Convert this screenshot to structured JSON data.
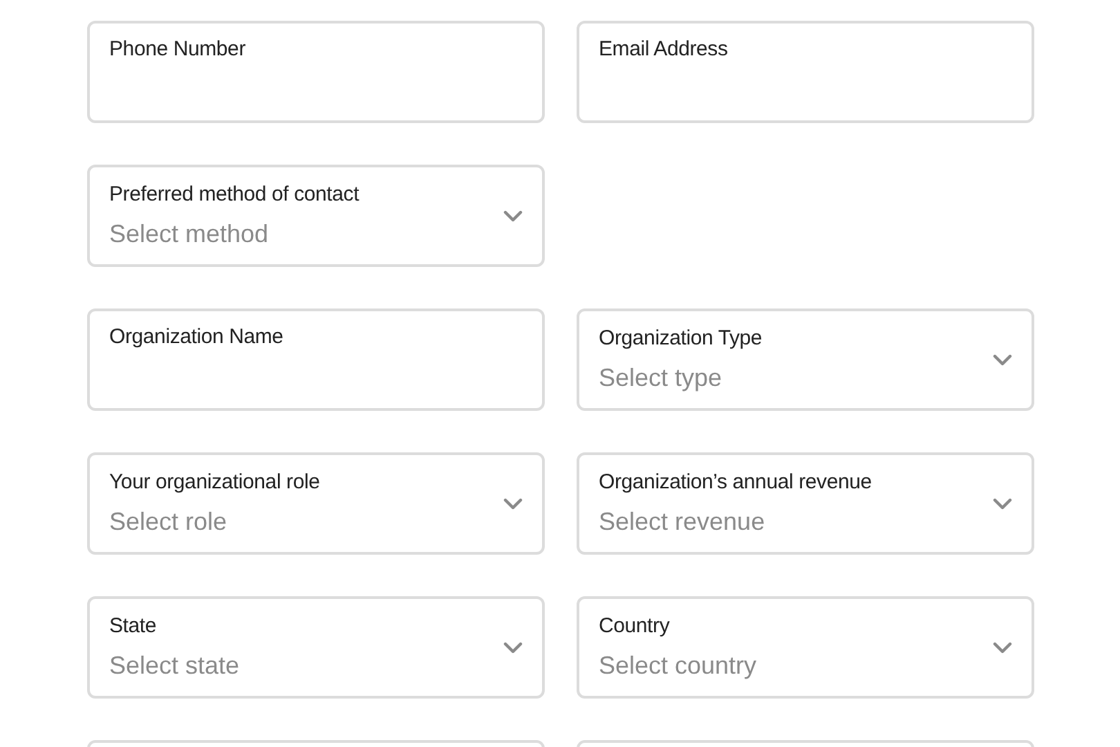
{
  "rows": [
    {
      "fields": [
        {
          "kind": "text",
          "label": "Phone Number"
        },
        {
          "kind": "text",
          "label": "Email Address"
        }
      ]
    },
    {
      "fields": [
        {
          "kind": "select",
          "label": "Preferred method of contact",
          "placeholder": "Select method"
        }
      ]
    },
    {
      "fields": [
        {
          "kind": "text",
          "label": "Organization Name"
        },
        {
          "kind": "select",
          "label": "Organization Type",
          "placeholder": "Select type"
        }
      ]
    },
    {
      "fields": [
        {
          "kind": "select",
          "label": "Your organizational role",
          "placeholder": "Select role"
        },
        {
          "kind": "select",
          "label": "Organization’s annual revenue",
          "placeholder": "Select revenue"
        }
      ]
    },
    {
      "fields": [
        {
          "kind": "select",
          "label": "State",
          "placeholder": "Select state"
        },
        {
          "kind": "select",
          "label": "Country",
          "placeholder": "Select country"
        }
      ]
    },
    {
      "fields": [
        {
          "kind": "text"
        },
        {
          "kind": "text"
        }
      ]
    }
  ]
}
